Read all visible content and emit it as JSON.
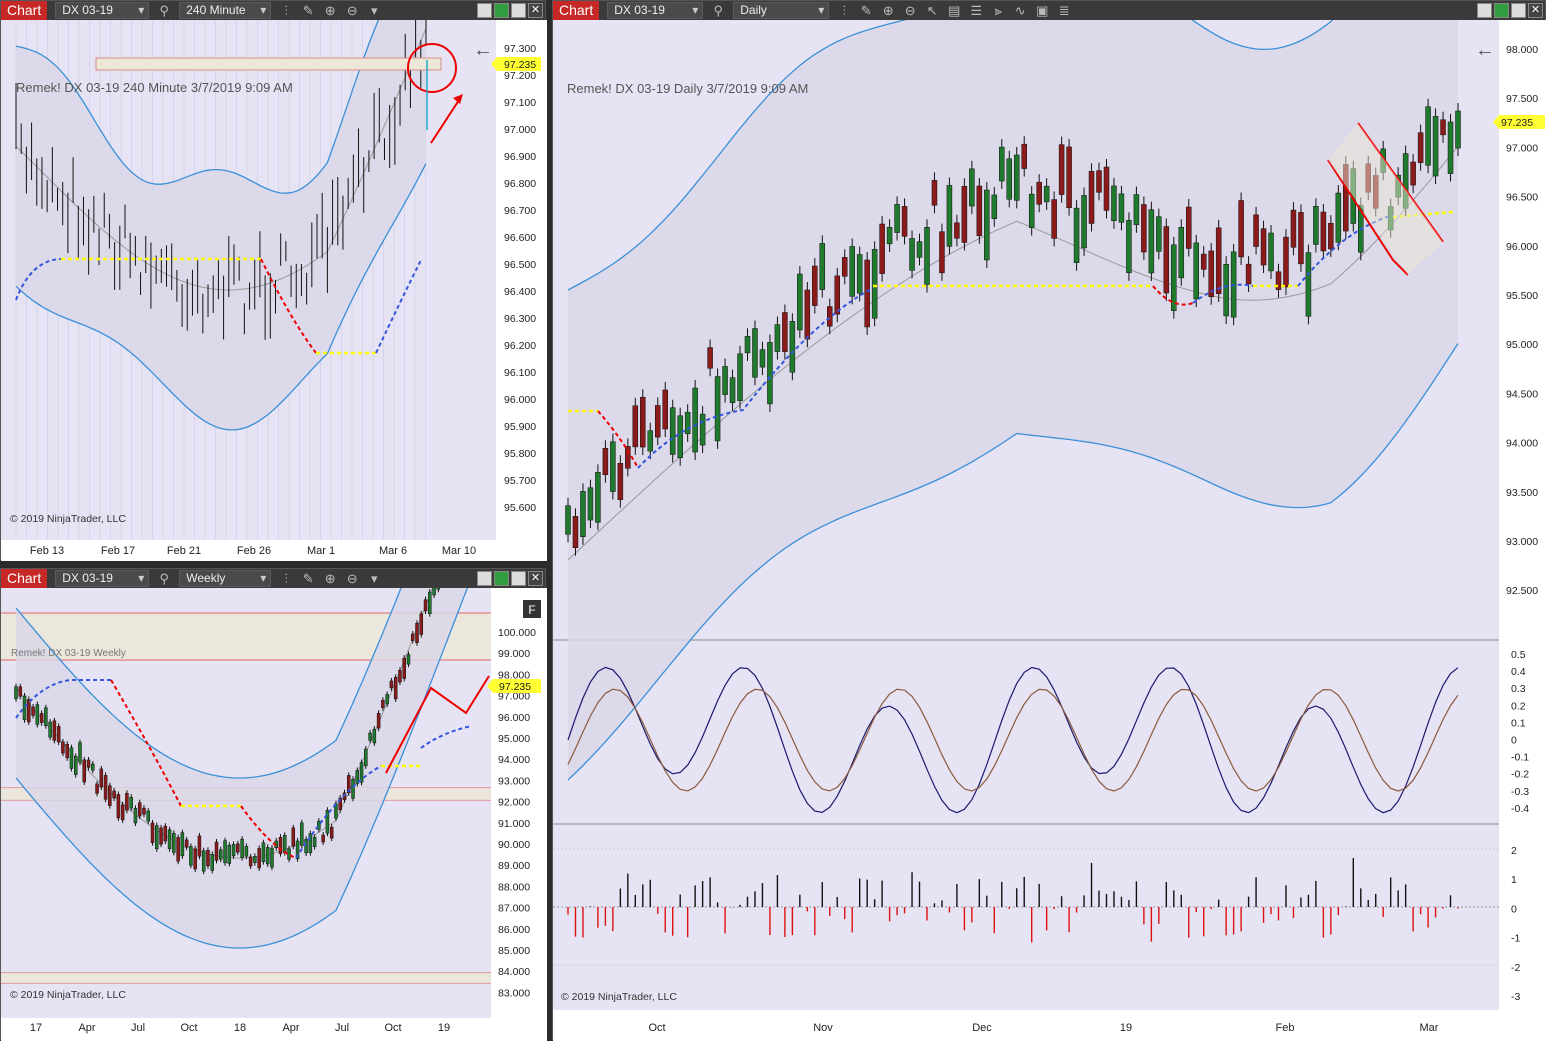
{
  "windows": {
    "w1": {
      "label": "Chart",
      "instrument": "DX 03-19",
      "period": "240 Minute",
      "title": "Remek!  DX 03-19  240 Minute  3/7/2019 9:09 AM",
      "copyright": "© 2019 NinjaTrader, LLC",
      "price_label": "97.235",
      "y_ticks": [
        "97.300",
        "97.200",
        "97.100",
        "97.000",
        "96.900",
        "96.800",
        "96.700",
        "96.600",
        "96.500",
        "96.400",
        "96.300",
        "96.200",
        "96.100",
        "96.000",
        "95.900",
        "95.800",
        "95.700",
        "95.600"
      ],
      "x_ticks": [
        "Feb 13",
        "Feb 17",
        "Feb 21",
        "Feb 26",
        "Mar 1",
        "Mar 6",
        "Mar 10"
      ]
    },
    "w2": {
      "label": "Chart",
      "instrument": "DX 03-19",
      "period": "Weekly",
      "title": "Remek!  DX 03-19  Weekly",
      "copyright": "© 2019 NinjaTrader, LLC",
      "price_label": "97.235",
      "f_button": "F",
      "y_ticks": [
        "100.000",
        "99.000",
        "98.000",
        "97.000",
        "96.000",
        "95.000",
        "94.000",
        "93.000",
        "92.000",
        "91.000",
        "90.000",
        "89.000",
        "88.000",
        "87.000",
        "86.000",
        "85.000",
        "84.000",
        "83.000"
      ],
      "x_ticks": [
        "17",
        "Apr",
        "Jul",
        "Oct",
        "18",
        "Apr",
        "Jul",
        "Oct",
        "19"
      ]
    },
    "w3": {
      "label": "Chart",
      "instrument": "DX 03-19",
      "period": "Daily",
      "title": "Remek!  DX 03-19  Daily  3/7/2019 9:09 AM",
      "copyright": "© 2019 NinjaTrader, LLC",
      "price_label": "97.235",
      "y_ticks": [
        "98.000",
        "97.500",
        "97.000",
        "96.500",
        "96.000",
        "95.500",
        "95.000",
        "94.500",
        "94.000",
        "93.500",
        "93.000",
        "92.500"
      ],
      "osc_ticks": [
        "0.5",
        "0.4",
        "0.3",
        "0.2",
        "0.1",
        "0",
        "-0.1",
        "-0.2",
        "-0.3",
        "-0.4"
      ],
      "hist_ticks": [
        "2",
        "1",
        "0",
        "-1",
        "-2",
        "-3"
      ],
      "x_ticks": [
        "Oct",
        "Nov",
        "Dec",
        "19",
        "Feb",
        "Mar"
      ]
    }
  },
  "colors": {
    "background": "#e6e4f4",
    "bull": "#1f7a2e",
    "bear": "#8b1a1a",
    "band": "#3a8fd8",
    "highlight": "#ffff00",
    "accent": "#c62828"
  },
  "icons": [
    "search-icon",
    "bar-chart-icon",
    "pencil-icon",
    "zoom-in-icon",
    "zoom-out-icon",
    "cursor-icon",
    "properties-icon",
    "chart-style-icon",
    "indicators-icon",
    "strategies-icon",
    "data-box-icon",
    "list-icon",
    "back-arrow-icon"
  ]
}
